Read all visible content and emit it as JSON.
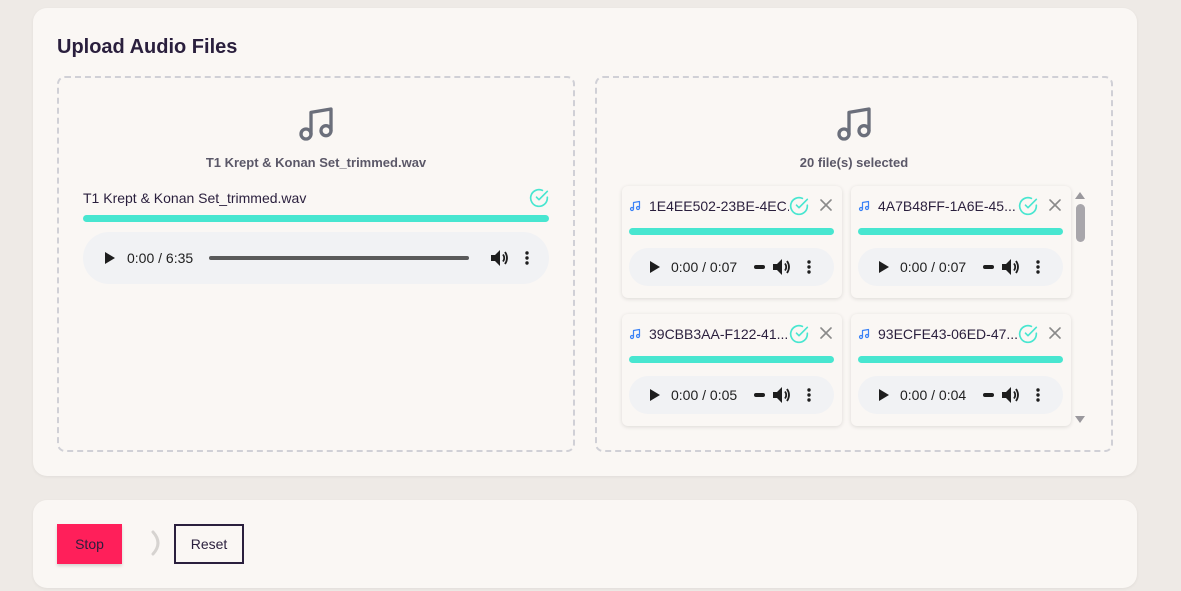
{
  "upload": {
    "title": "Upload Audio Files",
    "single": {
      "caption": "T1 Krept & Konan Set_trimmed.wav",
      "file_name": "T1 Krept & Konan Set_trimmed.wav",
      "progress": 1.0,
      "player_time": "0:00 / 6:35"
    },
    "multi": {
      "caption": "20 file(s) selected",
      "files": [
        {
          "name": "1E4EE502-23BE-4EC...",
          "time": "0:00 / 0:07",
          "progress": 1.0
        },
        {
          "name": "4A7B48FF-1A6E-45...",
          "time": "0:00 / 0:07",
          "progress": 1.0
        },
        {
          "name": "39CBB3AA-F122-41...",
          "time": "0:00 / 0:05",
          "progress": 1.0
        },
        {
          "name": "93ECFE43-06ED-47...",
          "time": "0:00 / 0:04",
          "progress": 1.0
        }
      ]
    }
  },
  "controls": {
    "stop_label": "Stop",
    "reset_label": "Reset"
  },
  "colors": {
    "accent": "#48e6d0",
    "stop": "#ff1f5a",
    "text": "#2a1f3d",
    "icon_note": "#6b6f7b",
    "small_note": "#3b82f6"
  }
}
